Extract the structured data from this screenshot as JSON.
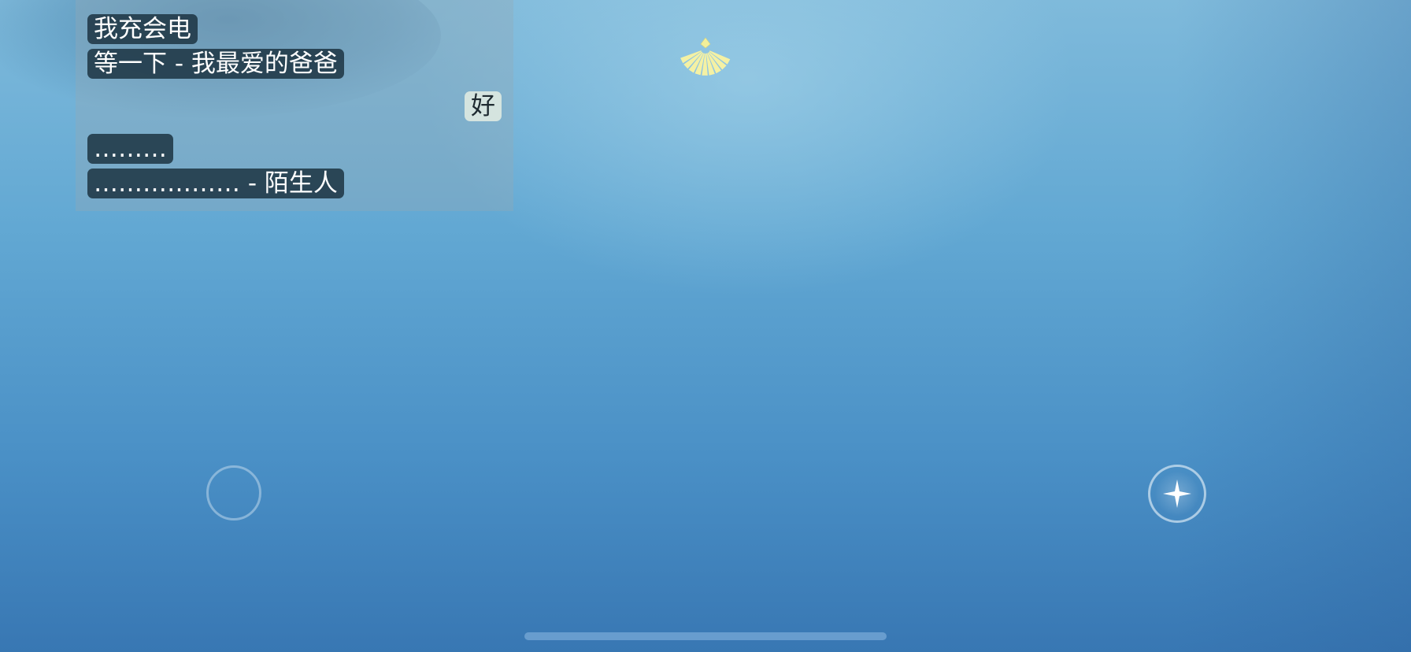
{
  "chat": {
    "messages": [
      {
        "text": "我充会电",
        "from": "other"
      },
      {
        "text": "等一下 - 我最爱的爸爸",
        "from": "other"
      },
      {
        "text": "好",
        "from": "self"
      },
      {
        "text": "………",
        "from": "other"
      },
      {
        "text": "……………… - 陌生人",
        "from": "other"
      }
    ]
  },
  "hud": {
    "top_icon": "winged-light-icon",
    "left_control": "joystick-ring-icon",
    "right_control": "sparkle-icon",
    "bottom_bar": "home-indicator"
  },
  "colors": {
    "sky_top": "#7fbadb",
    "sky_bottom": "#3877b3",
    "light_icon": "#f2ef9a",
    "bubble_other": "#1c3442",
    "bubble_self": "#dce8e1"
  }
}
